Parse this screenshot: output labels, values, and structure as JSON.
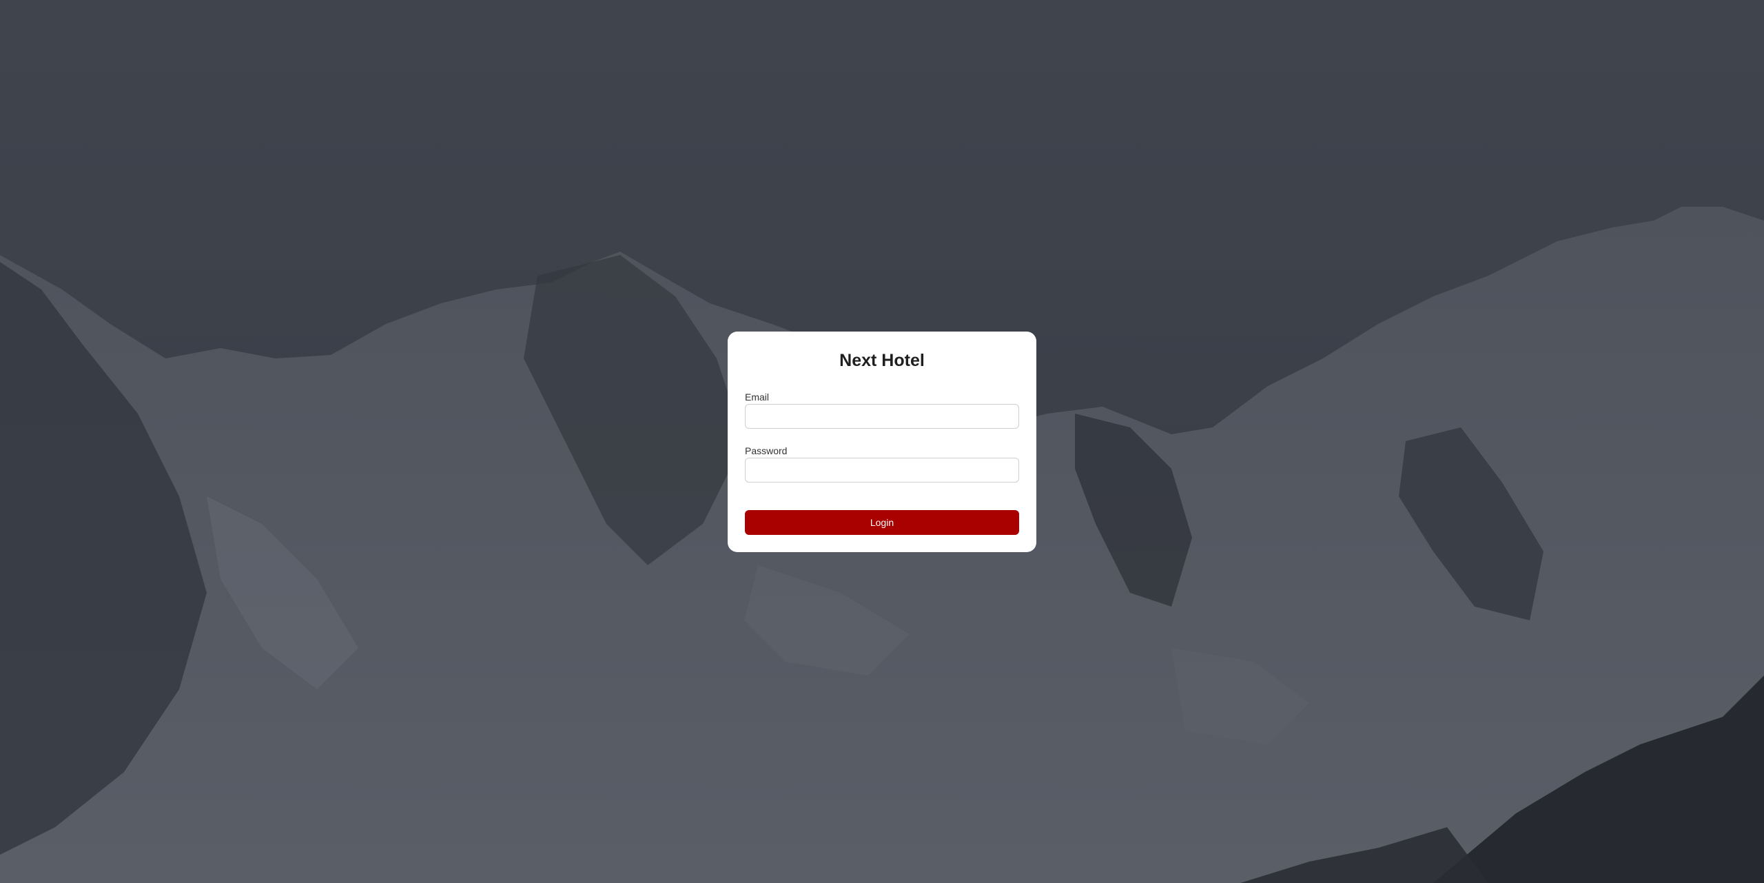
{
  "app": {
    "title": "Next Hotel"
  },
  "form": {
    "email_label": "Email",
    "email_value": "",
    "email_placeholder": "",
    "password_label": "Password",
    "password_value": "",
    "password_placeholder": "",
    "login_label": "Login"
  },
  "colors": {
    "overlay": "#3e424b",
    "card_bg": "#ffffff",
    "accent": "#a90000",
    "title_text": "#1f1f1f"
  },
  "background": {
    "image": "snowy-mountains-photo"
  }
}
